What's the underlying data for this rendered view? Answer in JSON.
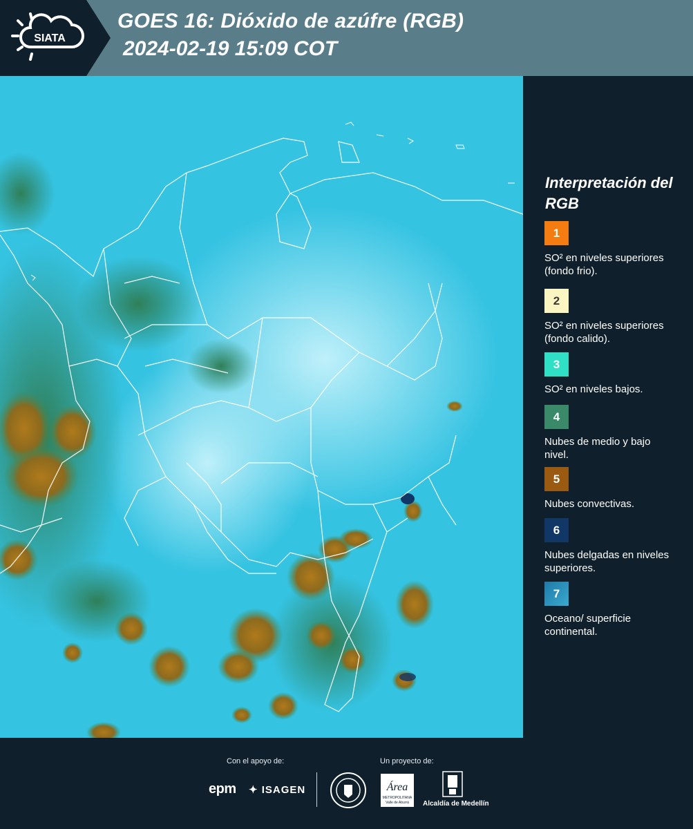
{
  "header": {
    "logo_text": "SIATA",
    "title_line1": "GOES 16: Dióxido de azúfre (RGB)",
    "title_line2": "2024-02-19 15:09 COT"
  },
  "map": {
    "background_color": "#35c3e2"
  },
  "legend": {
    "title": "Interpretación del RGB",
    "items": [
      {
        "number": "1",
        "color": "#f47c10",
        "label": "SO² en niveles superiores (fondo frio)."
      },
      {
        "number": "2",
        "color": "#fbf5c2",
        "label": "SO² en niveles superiores (fondo calido)."
      },
      {
        "number": "3",
        "color": "#2fe0c6",
        "label": "SO² en niveles bajos."
      },
      {
        "number": "4",
        "color": "#3a8a6a",
        "label": "Nubes de medio y bajo nivel."
      },
      {
        "number": "5",
        "color": "#9a5a12",
        "label": "Nubes convectivas."
      },
      {
        "number": "6",
        "color": "#103766",
        "label": "Nubes delgadas en niveles superiores."
      },
      {
        "number": "7",
        "color": "#2b8fb8",
        "label": "Oceano/ superficie continental."
      }
    ]
  },
  "footer": {
    "support_label": "Con el apoyo de:",
    "project_label": "Un proyecto de:",
    "sponsor1": "epm",
    "sponsor2": "ISAGEN",
    "area_logo_text": "Área",
    "area_sub": "METROPOLITANA",
    "area_sub2": "Valle de Aburrá",
    "medellin_label": "Alcaldía de Medellín"
  }
}
